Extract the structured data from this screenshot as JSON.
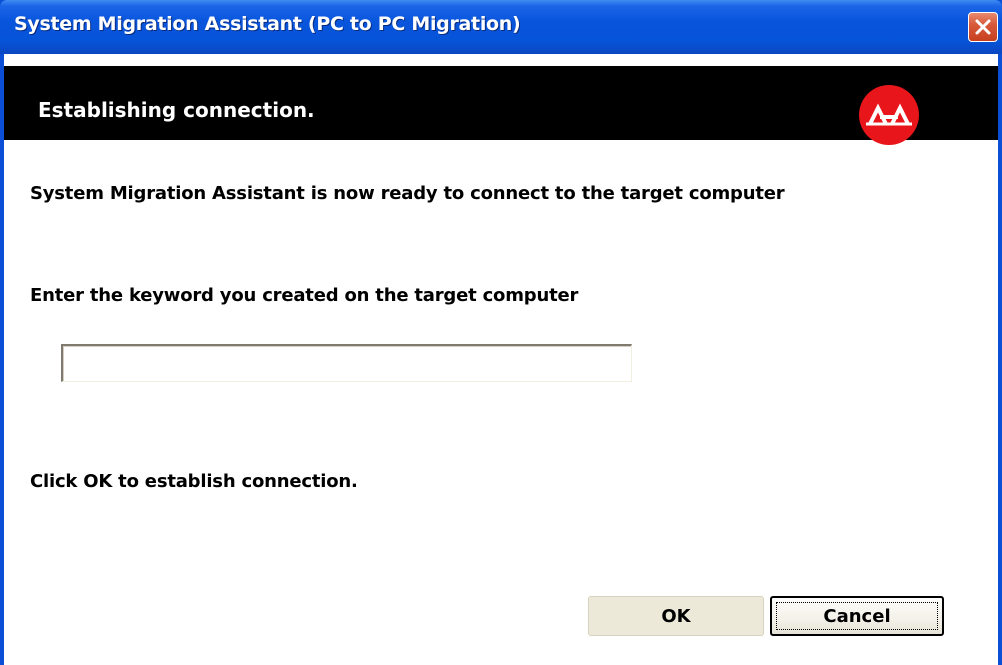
{
  "window": {
    "title": "System Migration Assistant (PC to PC Migration)",
    "close_icon": "close-icon"
  },
  "header": {
    "title": "Establishing connection.",
    "logo_icon": "migration-bridge-logo-icon",
    "logo_color": "#e8161b"
  },
  "content": {
    "ready_text": "System Migration Assistant is now ready to connect to the target computer",
    "keyword_prompt": "Enter the keyword you created on the target computer",
    "keyword_value": "",
    "instruction_text": "Click OK to establish connection."
  },
  "buttons": {
    "ok_label": "OK",
    "cancel_label": "Cancel"
  },
  "colors": {
    "titlebar": "#0855dd",
    "header_band": "#000000",
    "button_face": "#ece9d8"
  }
}
